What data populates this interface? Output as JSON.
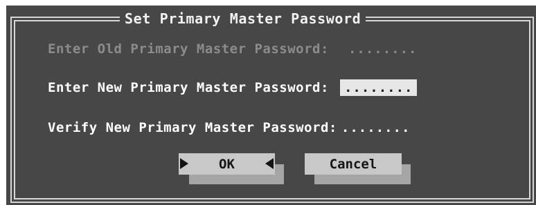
{
  "dialog": {
    "title": "Set Primary Master Password",
    "fields": {
      "old": {
        "label": "Enter Old Primary Master Password:",
        "value": "........"
      },
      "new": {
        "label": "Enter New Primary Master Password:",
        "value": "........"
      },
      "verify": {
        "label": "Verify New Primary Master Password:",
        "value": "........"
      }
    },
    "buttons": {
      "ok_label": "OK",
      "cancel_label": "Cancel"
    }
  },
  "icons": {
    "ok_left": "arrow-right-icon",
    "ok_right": "arrow-left-icon"
  },
  "colors": {
    "dialog_background": "#474747",
    "frame_line": "#d8d8d8",
    "disabled_text": "#8c8c8c",
    "active_text": "#ffffff",
    "button_face": "#c8c8c8",
    "button_shadow": "#a5a5a5",
    "input_highlight": "#e6e6e6"
  }
}
